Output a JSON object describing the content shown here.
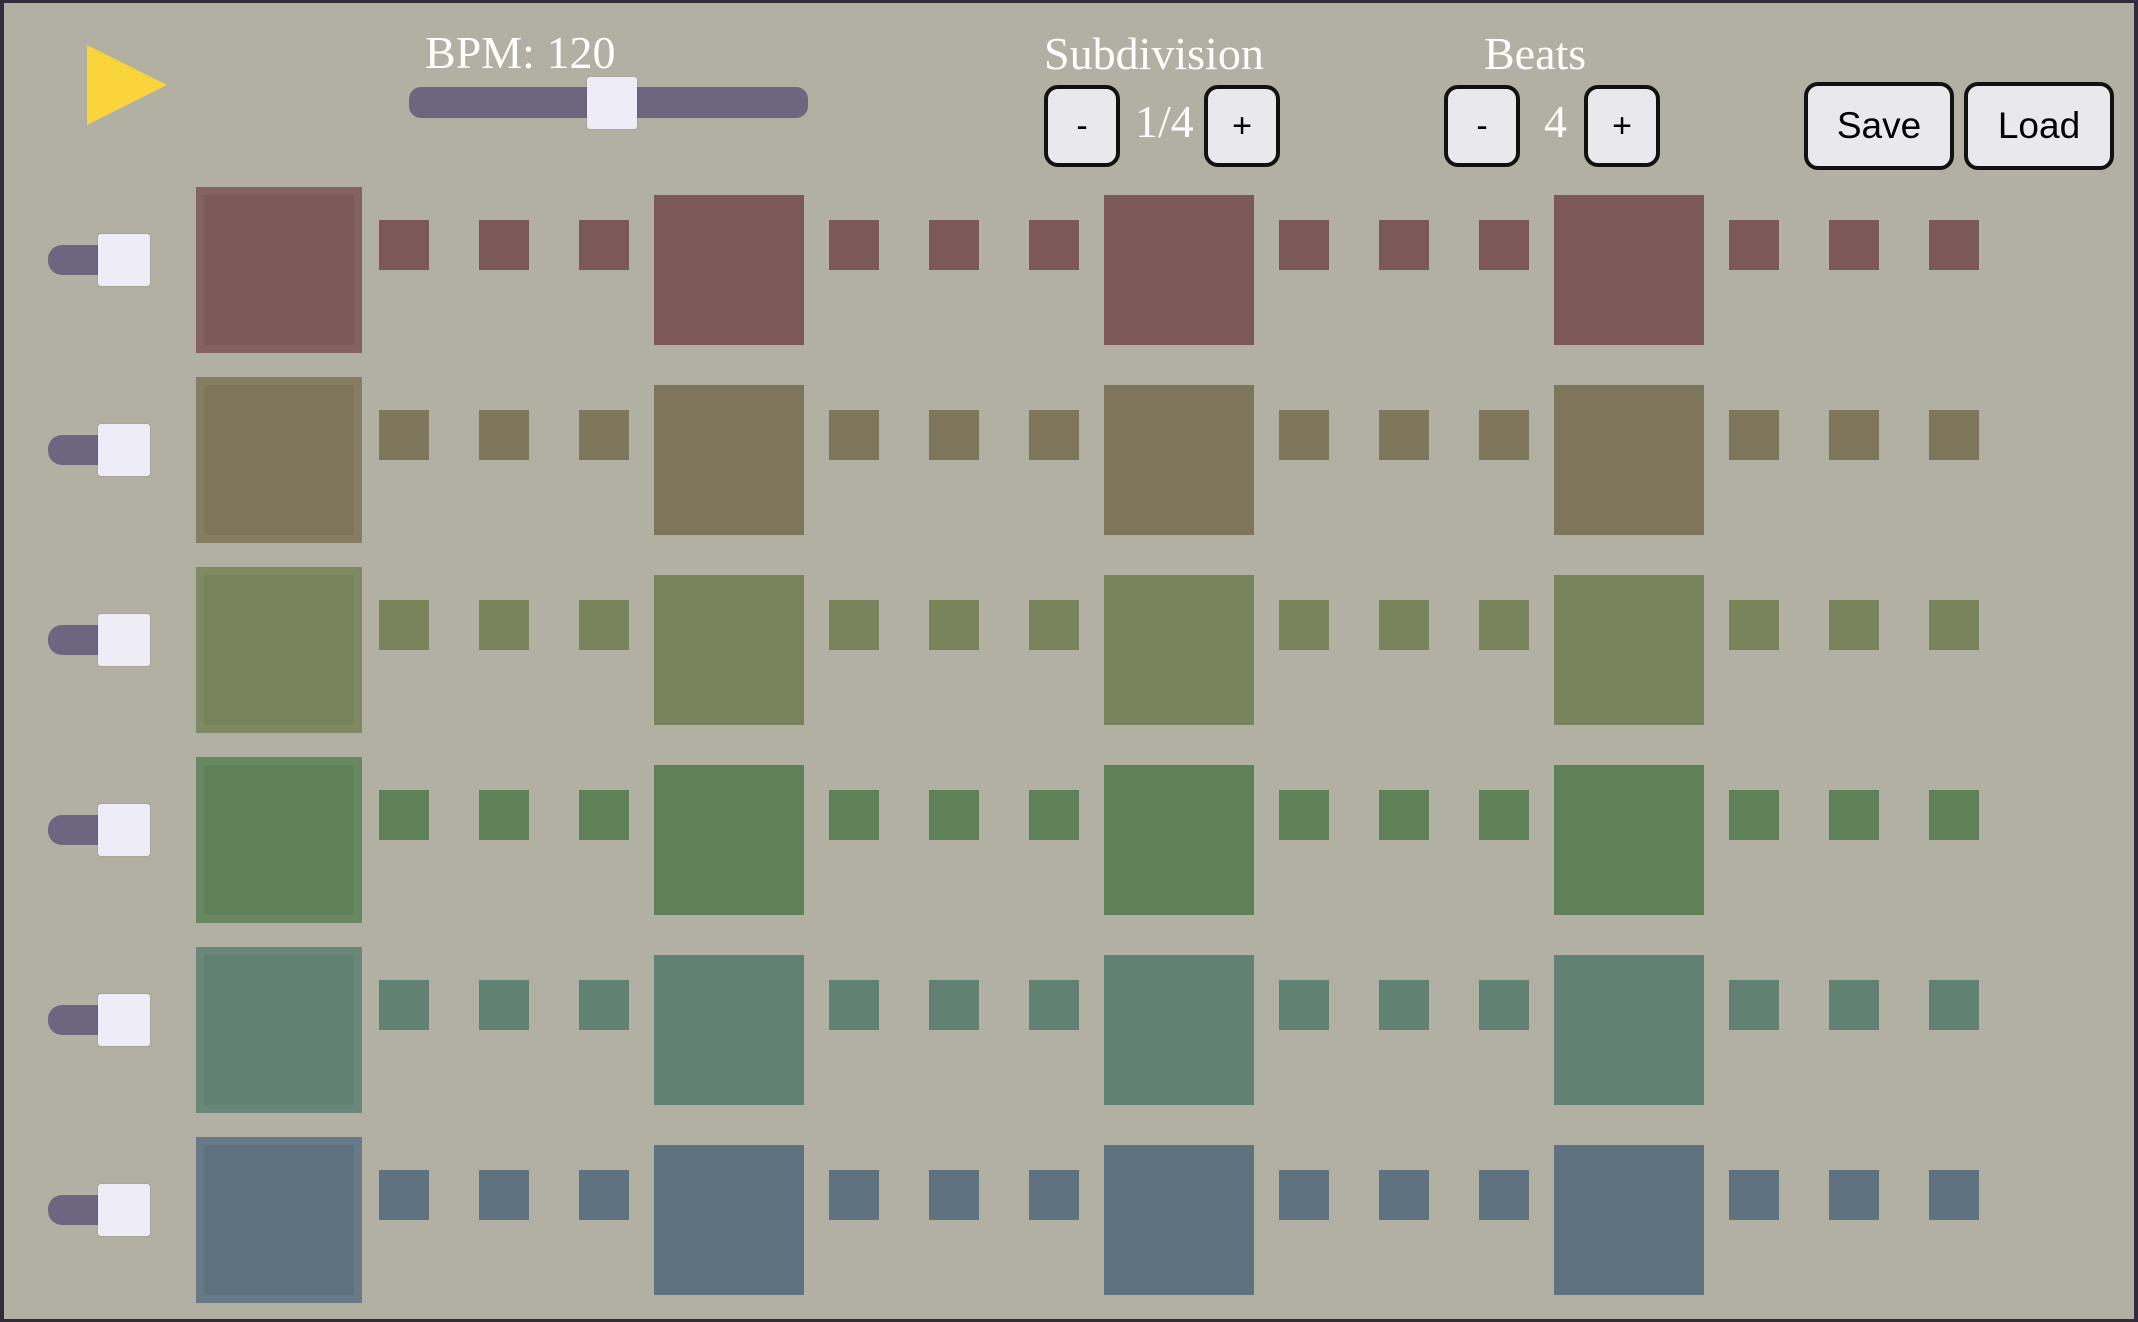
{
  "transport": {
    "play_icon": "play-triangle-icon",
    "play_color": "#f9d43b"
  },
  "bpm": {
    "label": "BPM:",
    "value": "120",
    "min": 40,
    "max": 240,
    "current": 120
  },
  "subdivision": {
    "title": "Subdivision",
    "minus_label": "-",
    "value": "1/4",
    "plus_label": "+"
  },
  "beats": {
    "title": "Beats",
    "minus_label": "-",
    "value": "4",
    "plus_label": "+"
  },
  "file": {
    "save_label": "Save",
    "load_label": "Load"
  },
  "grid": {
    "beats": 4,
    "steps_per_beat": 4,
    "rows": [
      {
        "color": "#7c5957",
        "volume": 0.5
      },
      {
        "color": "#7e765a",
        "volume": 0.5
      },
      {
        "color": "#78825b",
        "volume": 0.5
      },
      {
        "color": "#5f8158",
        "volume": 0.5
      },
      {
        "color": "#618172",
        "volume": 0.5
      },
      {
        "color": "#5f7280",
        "volume": 0.5
      }
    ]
  }
}
